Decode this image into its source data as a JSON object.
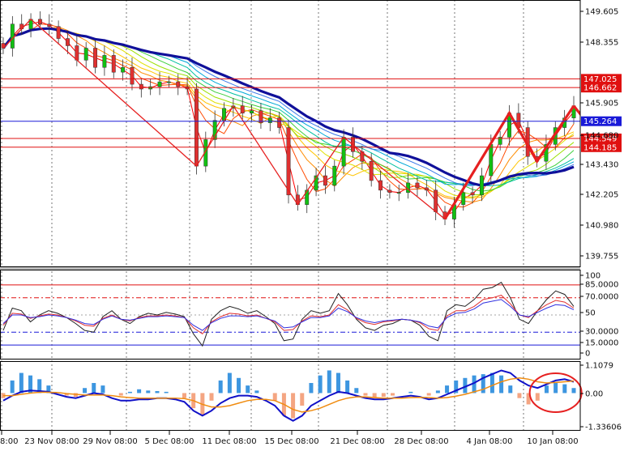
{
  "chart_data": [
    {
      "type": "candlestick",
      "panel": "price",
      "ylim": [
        139.2,
        150.3
      ],
      "y_ticks": [
        "149.605",
        "148.355",
        "145.905",
        "144.680",
        "143.430",
        "142.205",
        "140.980",
        "139.755"
      ],
      "x_ticks": [
        "8:00",
        "23 Nov 08:00",
        "29 Nov 08:00",
        "5 Dec 08:00",
        "11 Dec 08:00",
        "15 Dec 08:00",
        "21 Dec 08:00",
        "28 Dec 08:00",
        "4 Jan 08:00",
        "10 Jan 08:00"
      ],
      "closes": [
        148.3,
        149.3,
        149.1,
        149.5,
        149.3,
        149.2,
        148.7,
        148.4,
        147.8,
        148.3,
        147.5,
        148.0,
        147.3,
        147.5,
        146.8,
        146.6,
        146.7,
        146.9,
        146.9,
        146.7,
        146.6,
        143.4,
        144.5,
        145.3,
        145.8,
        145.9,
        145.6,
        145.7,
        145.2,
        145.4,
        145.0,
        142.2,
        141.8,
        142.4,
        143.0,
        142.6,
        143.4,
        144.6,
        144.0,
        143.6,
        142.8,
        142.4,
        142.3,
        142.3,
        142.7,
        142.5,
        142.4,
        141.5,
        141.2,
        141.8,
        142.3,
        142.2,
        143.0,
        144.3,
        144.6,
        145.6,
        145.0,
        143.8,
        143.6,
        144.3,
        145.0,
        145.4,
        145.9
      ],
      "levels": [
        {
          "label": "147.025",
          "value": 147.025,
          "color": "#e01010"
        },
        {
          "label": "146.662",
          "value": 146.662,
          "color": "#e01010"
        },
        {
          "label": "145.264",
          "value": 145.264,
          "color": "#1a1ad8"
        },
        {
          "label": "144.549",
          "value": 144.549,
          "color": "#e01010"
        },
        {
          "label": "144.185",
          "value": 144.185,
          "color": "#e01010"
        }
      ],
      "colors": {
        "candle_up": "#12c012",
        "candle_down": "#e03030",
        "ribbon_fast": "#e02020",
        "ribbon_slow": "#10109a",
        "zigzag": "#e62020"
      }
    },
    {
      "type": "line",
      "panel": "oscillator",
      "ylim": [
        0,
        100
      ],
      "y_ticks": [
        "100",
        "85.0000",
        "70.0000",
        "50",
        "30.0000",
        "15.0000",
        "0"
      ],
      "levels": [
        {
          "label": "85.0000",
          "value": 85,
          "color": "#e01010"
        },
        {
          "label": "70.0000",
          "value": 70,
          "color": "#e01010"
        },
        {
          "label": "30.0000",
          "value": 30,
          "color": "#1a1ad8"
        },
        {
          "label": "15.0000",
          "value": 15,
          "color": "#1a1ad8"
        }
      ],
      "series": [
        {
          "color": "#222222",
          "values": [
            32,
            58,
            55,
            42,
            50,
            55,
            52,
            47,
            40,
            32,
            30,
            48,
            55,
            45,
            40,
            48,
            52,
            50,
            53,
            51,
            48,
            28,
            14,
            45,
            55,
            60,
            57,
            52,
            55,
            48,
            40,
            20,
            22,
            45,
            55,
            52,
            55,
            75,
            62,
            45,
            35,
            32,
            38,
            40,
            45,
            44,
            38,
            25,
            20,
            55,
            62,
            60,
            68,
            80,
            82,
            88,
            70,
            45,
            40,
            55,
            68,
            78,
            74,
            60
          ]
        },
        {
          "color": "#e03030",
          "values": [
            38,
            52,
            51,
            46,
            49,
            51,
            50,
            47,
            43,
            38,
            37,
            46,
            50,
            45,
            43,
            47,
            49,
            49,
            50,
            49,
            47,
            35,
            28,
            42,
            48,
            52,
            51,
            49,
            50,
            46,
            42,
            32,
            33,
            43,
            49,
            48,
            50,
            62,
            56,
            46,
            41,
            39,
            42,
            43,
            45,
            44,
            41,
            34,
            32,
            49,
            55,
            55,
            60,
            68,
            70,
            73,
            63,
            50,
            47,
            55,
            62,
            67,
            65,
            58
          ]
        },
        {
          "color": "#3030e0",
          "values": [
            40,
            50,
            50,
            47,
            48,
            50,
            49,
            47,
            44,
            40,
            39,
            45,
            49,
            45,
            44,
            46,
            48,
            48,
            49,
            48,
            47,
            38,
            32,
            41,
            46,
            49,
            49,
            48,
            49,
            46,
            43,
            35,
            36,
            42,
            47,
            47,
            49,
            58,
            54,
            47,
            43,
            41,
            43,
            44,
            45,
            44,
            42,
            37,
            35,
            47,
            52,
            53,
            57,
            64,
            66,
            68,
            60,
            50,
            48,
            53,
            58,
            62,
            61,
            56
          ]
        }
      ]
    },
    {
      "type": "histogram",
      "panel": "macd",
      "ylim": [
        -1.33606,
        1.1079
      ],
      "y_ticks": [
        "1.1079",
        "0.00",
        "-1.33606"
      ],
      "histogram": [
        -0.2,
        0.5,
        0.8,
        0.7,
        0.55,
        0.3,
        0,
        -0.1,
        -0.15,
        0.2,
        0.4,
        0.3,
        0,
        -0.1,
        0.05,
        0.15,
        0.1,
        0.08,
        0.05,
        0,
        -0.2,
        -0.6,
        -0.9,
        -0.3,
        0.5,
        0.8,
        0.6,
        0.3,
        0.1,
        0,
        -0.3,
        -0.9,
        -1.0,
        -0.5,
        0.4,
        0.7,
        0.9,
        0.8,
        0.5,
        0.2,
        -0.1,
        -0.2,
        -0.15,
        -0.1,
        0,
        0.05,
        0,
        -0.1,
        0.1,
        0.3,
        0.5,
        0.6,
        0.7,
        0.75,
        0.8,
        0.7,
        0.3,
        -0.2,
        -0.45,
        -0.3,
        0.3,
        0.4,
        0.35,
        0.2
      ],
      "series": [
        {
          "color": "#1010c8",
          "values": [
            -0.3,
            -0.1,
            0.05,
            0.1,
            0.08,
            0.05,
            -0.05,
            -0.15,
            -0.2,
            -0.1,
            0,
            -0.05,
            -0.2,
            -0.3,
            -0.3,
            -0.25,
            -0.25,
            -0.2,
            -0.2,
            -0.25,
            -0.35,
            -0.7,
            -0.9,
            -0.7,
            -0.4,
            -0.2,
            -0.1,
            -0.1,
            -0.15,
            -0.3,
            -0.5,
            -0.9,
            -1.1,
            -0.9,
            -0.5,
            -0.3,
            -0.1,
            0.05,
            0,
            -0.1,
            -0.2,
            -0.25,
            -0.25,
            -0.2,
            -0.15,
            -0.1,
            -0.15,
            -0.25,
            -0.2,
            -0.05,
            0.1,
            0.25,
            0.4,
            0.6,
            0.75,
            0.9,
            0.8,
            0.5,
            0.3,
            0.2,
            0.35,
            0.5,
            0.55,
            0.45
          ]
        },
        {
          "color": "#f08c10",
          "values": [
            -0.1,
            -0.1,
            -0.05,
            0,
            0.03,
            0.03,
            0.02,
            -0.02,
            -0.05,
            -0.08,
            -0.08,
            -0.08,
            -0.1,
            -0.15,
            -0.18,
            -0.2,
            -0.2,
            -0.2,
            -0.2,
            -0.2,
            -0.22,
            -0.3,
            -0.45,
            -0.55,
            -0.55,
            -0.5,
            -0.4,
            -0.3,
            -0.25,
            -0.25,
            -0.3,
            -0.45,
            -0.65,
            -0.75,
            -0.7,
            -0.6,
            -0.45,
            -0.3,
            -0.2,
            -0.15,
            -0.15,
            -0.18,
            -0.2,
            -0.2,
            -0.2,
            -0.18,
            -0.17,
            -0.18,
            -0.2,
            -0.18,
            -0.12,
            -0.05,
            0.05,
            0.15,
            0.3,
            0.45,
            0.55,
            0.6,
            0.55,
            0.45,
            0.4,
            0.42,
            0.45,
            0.48
          ]
        }
      ]
    }
  ]
}
